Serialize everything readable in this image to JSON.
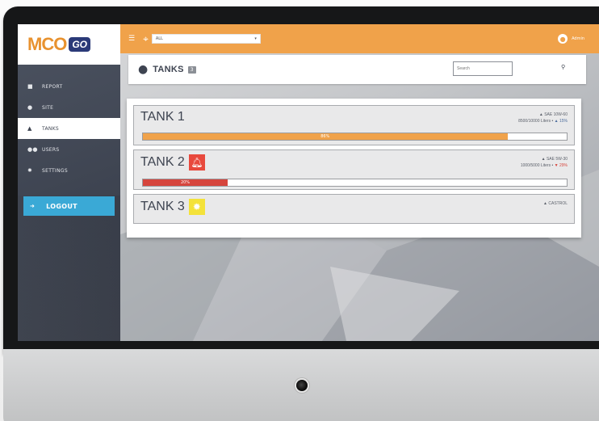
{
  "brand": {
    "name": "MCO",
    "tag": "GO",
    "accent": "#f0a24a",
    "sidebar_bg": "#3e4451",
    "logout_bg": "#3aa9d6"
  },
  "topbar": {
    "site_filter_value": "ALL",
    "user_label": "Admin"
  },
  "sidebar": {
    "items": [
      {
        "label": "REPORT",
        "icon": "square-icon",
        "active": false
      },
      {
        "label": "SITE",
        "icon": "pin-icon",
        "active": false
      },
      {
        "label": "TANKS",
        "icon": "drop-icon",
        "active": true
      },
      {
        "label": "USERS",
        "icon": "users-icon",
        "active": false
      },
      {
        "label": "SETTINGS",
        "icon": "gear-icon",
        "active": false
      }
    ],
    "logout_label": "LOGOUT"
  },
  "header": {
    "title": "TANKS",
    "count": "3",
    "search_placeholder": "Search"
  },
  "tanks": [
    {
      "name": "TANK 1",
      "product": "SAE 10W-60",
      "volume": "8500/10000 Liters",
      "change": "15%",
      "change_dir": "up",
      "fill": 0.86,
      "fill_label": "86%",
      "bar_color": "#f0a24a",
      "alarm": "none"
    },
    {
      "name": "TANK 2",
      "product": "SAE 5W-30",
      "volume": "1000/5000 Liters",
      "change": "29%",
      "change_dir": "down",
      "fill": 0.2,
      "fill_label": "20%",
      "bar_color": "#d6453d",
      "alarm": "bell-icon",
      "alarm_color": "#e8493d"
    },
    {
      "name": "TANK 3",
      "product": "CASTROL",
      "alarm": "gear-icon",
      "alarm_color": "#f4e23a"
    }
  ]
}
